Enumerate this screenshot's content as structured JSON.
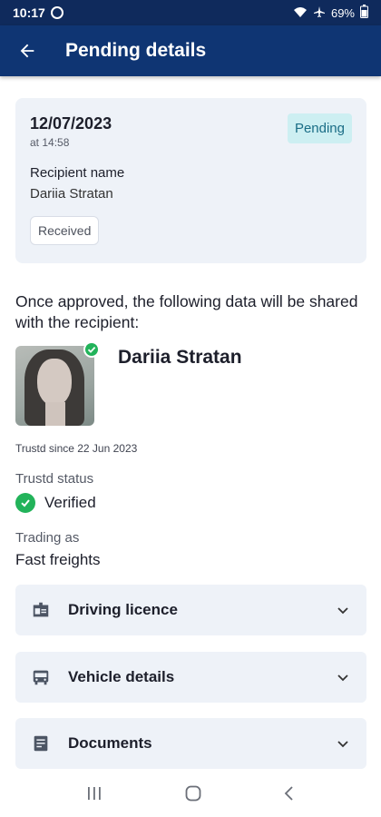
{
  "status_bar": {
    "time": "10:17",
    "battery": "69%",
    "icons": [
      "data-saver-icon",
      "wifi-icon",
      "airplane-icon"
    ]
  },
  "app_bar": {
    "title": "Pending details",
    "back_icon": "arrow-left-icon"
  },
  "summary": {
    "date": "12/07/2023",
    "time": "at 14:58",
    "status_badge": "Pending",
    "recipient_label": "Recipient name",
    "recipient_name": "Dariia Stratan",
    "chip": "Received"
  },
  "share_notice": "Once approved, the following data will be shared with the recipient:",
  "profile": {
    "name": "Dariia Stratan",
    "since": "Trustd since 22 Jun 2023",
    "status_label": "Trustd status",
    "status_value": "Verified",
    "trading_label": "Trading as",
    "trading_value": "Fast freights"
  },
  "sections": [
    {
      "label": "Driving licence",
      "icon": "id-card-icon"
    },
    {
      "label": "Vehicle details",
      "icon": "bus-icon"
    },
    {
      "label": "Documents",
      "icon": "document-icon"
    }
  ],
  "colors": {
    "app_bar": "#0f3573",
    "status_bar": "#0f2a5c",
    "card_bg": "#eef2f8",
    "pending_badge_bg": "#cdeff2",
    "pending_badge_text": "#1a6d86",
    "verified_green": "#22b35a"
  }
}
